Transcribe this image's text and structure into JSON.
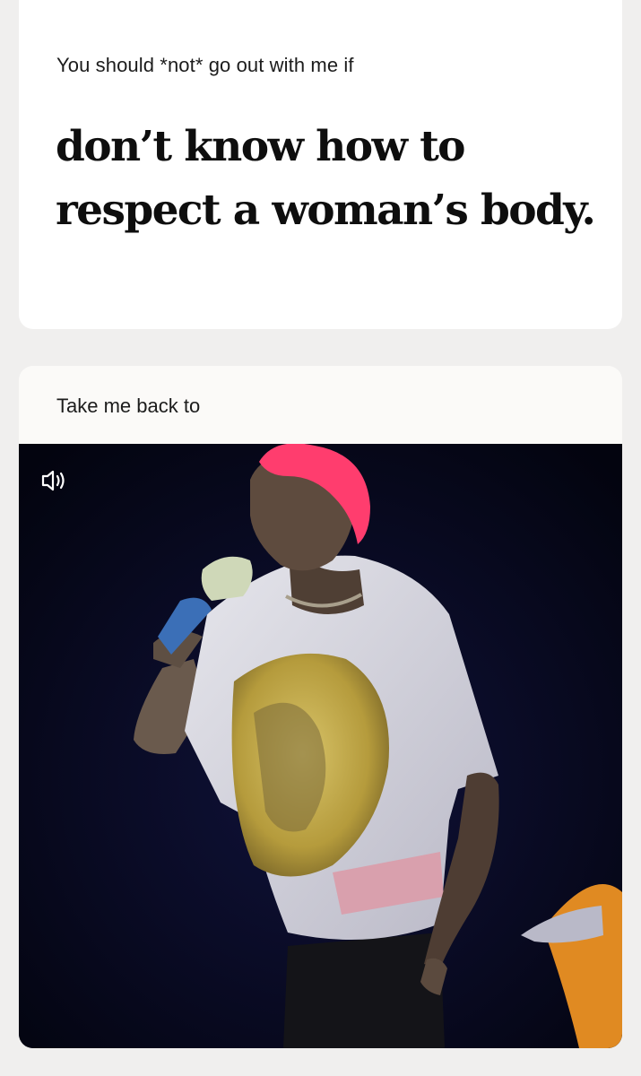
{
  "prompt_card": {
    "label": "You should *not* go out with me if",
    "answer_line1": "don’t know how to",
    "answer_line2": "respect a woman’s body."
  },
  "media_card": {
    "label": "Take me back to",
    "sound_icon": "speaker-sound-icon"
  },
  "colors": {
    "page_background": "#f0efee",
    "card_background": "#ffffff",
    "text": "#0e0e0e",
    "photo_background": "#06071a",
    "hair": "#ff3d6e"
  }
}
